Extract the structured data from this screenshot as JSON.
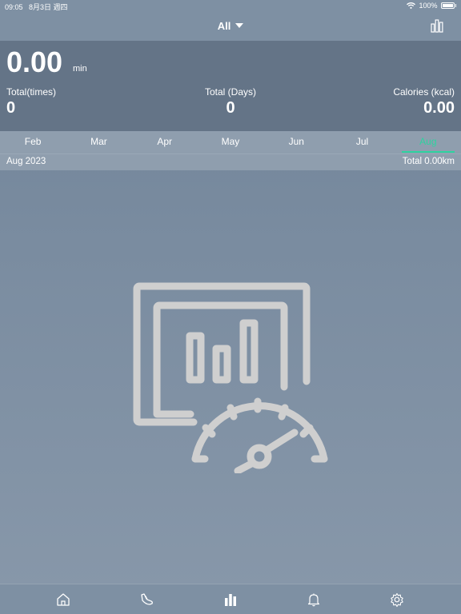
{
  "status_bar": {
    "time": "09:05",
    "date": "8月3日 週四",
    "battery": "100%"
  },
  "nav": {
    "filter_label": "All",
    "chart_icon": "bar-chart-icon"
  },
  "summary": {
    "value": "0.00",
    "unit": "min",
    "stats": [
      {
        "label": "Total(times)",
        "value": "0"
      },
      {
        "label": "Total (Days)",
        "value": "0"
      },
      {
        "label": "Calories (kcal)",
        "value": "0.00"
      }
    ]
  },
  "months": [
    "Feb",
    "Mar",
    "Apr",
    "May",
    "Jun",
    "Jul",
    "Aug"
  ],
  "selected_month": "Aug",
  "subbar": {
    "period": "Aug 2023",
    "total": "Total 0.00km"
  },
  "colors": {
    "accent": "#2ed3a0"
  },
  "tabs": [
    {
      "icon": "home-icon"
    },
    {
      "icon": "shoe-icon"
    },
    {
      "icon": "bar-chart-icon"
    },
    {
      "icon": "bell-icon"
    },
    {
      "icon": "gear-icon"
    }
  ]
}
